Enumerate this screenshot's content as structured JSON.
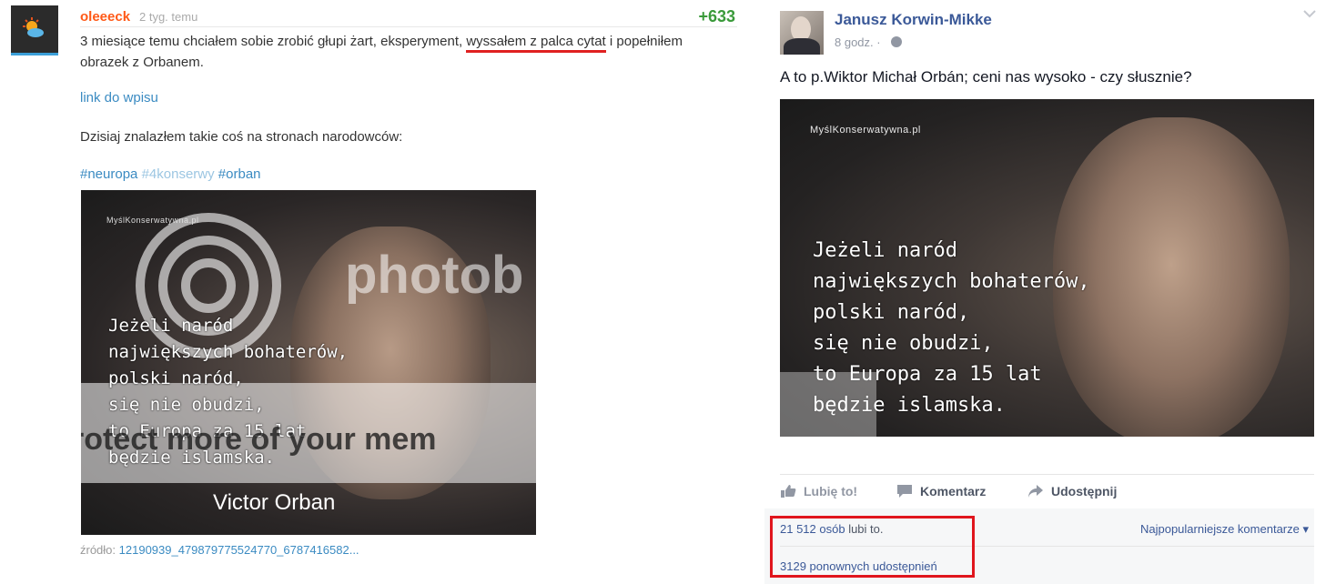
{
  "left_entry": {
    "username": "oleeeck",
    "time": "2 tyg. temu",
    "votes": "+633",
    "text_part1": "3 miesiące temu chciałem sobie zrobić głupi żart, eksperyment, ",
    "text_underlined": "wyssałem z palca cytat",
    "text_part2": " i popełniłem obrazek z Orbanem.",
    "link_label": "link do wpisu",
    "paragraph2": "Dzisiaj znalazłem takie coś na stronach narodowców:",
    "tags": [
      "#neuropa",
      "#4konserwy",
      "#orban"
    ],
    "image": {
      "watermark_top": "photob",
      "watermark_bottom": "rotect more of your mem",
      "brand": "MyślKonserwatywna.pl",
      "quote": "Jeżeli naród\nnajwiększych bohaterów,\npolski naród,\nsię nie obudzi,\nto Europa za 15 lat\nbędzie islamska.",
      "signature": "Victor Orban"
    },
    "source_label": "źródło:",
    "source_value": "12190939_479879775524770_6787416582..."
  },
  "fb_post": {
    "author": "Janusz Korwin-Mikke",
    "time": "8 godz. ·",
    "message": "A to p.Wiktor Michał Orbán; ceni nas wysoko - czy słusznie?",
    "image": {
      "brand": "MyślKonserwatywna.pl",
      "quote": "Jeżeli naród\nnajwiększych bohaterów,\npolski naród,\nsię nie obudzi,\nto Europa za 15 lat\nbędzie islamska."
    },
    "actions": {
      "like": "Lubię to!",
      "comment": "Komentarz",
      "share": "Udostępnij"
    },
    "likes_count": "21 512 osób",
    "likes_suffix": " lubi to.",
    "popular_label": "Najpopularniejsze komentarze ▾",
    "shares": "3129 ponownych udostępnień"
  },
  "colors": {
    "wykop_user": "#ff5917",
    "votes": "#3a9a3a",
    "link": "#3b8bc2",
    "fb_blue": "#3b5998",
    "highlight_red": "#e0151d"
  }
}
